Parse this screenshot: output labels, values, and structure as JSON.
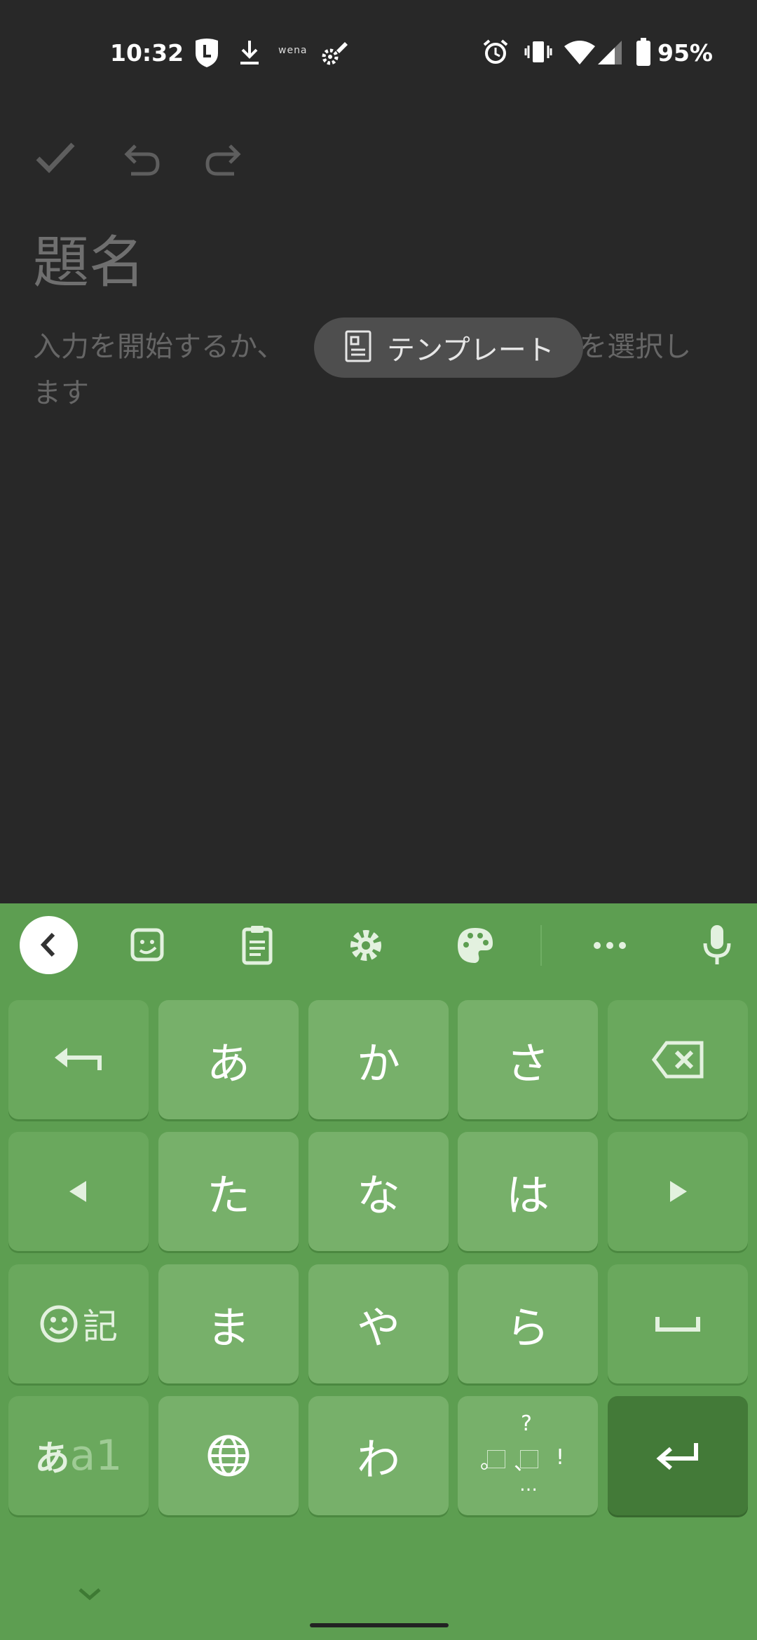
{
  "status_bar": {
    "time": "10:32",
    "wena_text": "wena",
    "battery_percent": "95%",
    "icons": [
      "line-app-icon",
      "download-icon",
      "wena-icon",
      "satellite-settings-icon",
      "alarm-icon",
      "vibrate-icon",
      "wifi-icon",
      "signal-icon",
      "battery-icon"
    ]
  },
  "editor": {
    "title_placeholder": "題名",
    "body_before": "入力を開始するか、",
    "template_chip_label": "テンプレート",
    "body_after_line1": "を選択し",
    "body_after_line2": "ます",
    "toolbar_icons": [
      "check-icon",
      "undo-icon",
      "redo-icon"
    ]
  },
  "keyboard": {
    "theme_color": "#5d9e51",
    "toolbar_icons": [
      "back-chevron-icon",
      "sticker-icon",
      "clipboard-icon",
      "settings-icon",
      "palette-icon",
      "more-icon",
      "microphone-icon"
    ],
    "rows": [
      [
        "undo-arrow",
        "あ",
        "か",
        "さ",
        "backspace"
      ],
      [
        "left-arrow",
        "た",
        "な",
        "は",
        "right-arrow"
      ],
      [
        "emoji-symbol",
        "ま",
        "や",
        "ら",
        "space"
      ],
      [
        "mode-switch",
        "globe",
        "わ",
        "punctuation",
        "enter"
      ]
    ],
    "emoji_key_label": "記",
    "mode_key_hira": "あ",
    "mode_key_alpha": "a1",
    "punct_top": "?",
    "punct_left": "。",
    "punct_mid": "、",
    "punct_right": "!",
    "punct_bottom": "…",
    "key_a": "あ",
    "key_ka": "か",
    "key_sa": "さ",
    "key_ta": "た",
    "key_na": "な",
    "key_ha": "は",
    "key_ma": "ま",
    "key_ya": "や",
    "key_ra": "ら",
    "key_wa": "わ"
  }
}
